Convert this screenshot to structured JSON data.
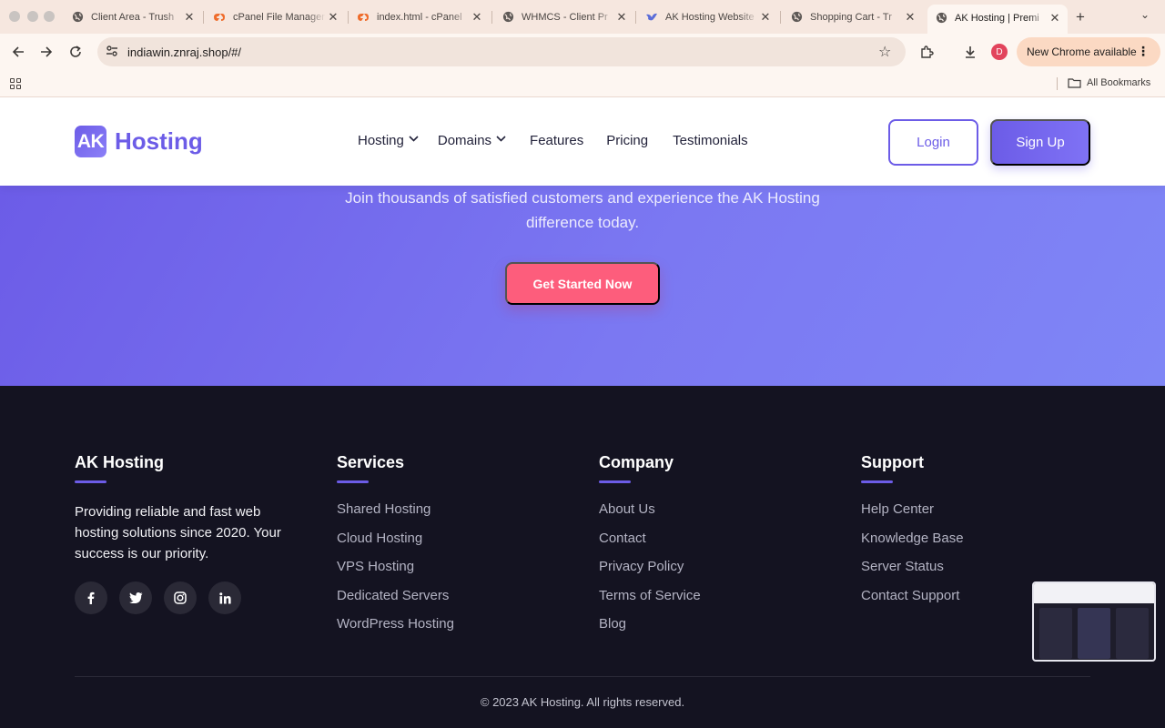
{
  "browser": {
    "tabs": [
      {
        "title": "Client Area - Trush",
        "favicon": "globe-icon"
      },
      {
        "title": "cPanel File Manager",
        "favicon": "cpanel-icon"
      },
      {
        "title": "index.html - cPanel",
        "favicon": "cpanel-icon"
      },
      {
        "title": "WHMCS - Client Pr",
        "favicon": "globe-icon"
      },
      {
        "title": "AK Hosting Website",
        "favicon": "bird-icon"
      },
      {
        "title": "Shopping Cart - Tr",
        "favicon": "globe-icon"
      },
      {
        "title": "AK Hosting | Premi",
        "favicon": "globe-icon",
        "active": true
      }
    ],
    "url": "indiawin.znraj.shop/#/",
    "profile_initial": "D",
    "update_label": "New Chrome available",
    "bookmarks_label": "All Bookmarks"
  },
  "header": {
    "logo_mark": "AK",
    "logo_text": "Hosting",
    "nav": [
      {
        "label": "Hosting",
        "dropdown": true
      },
      {
        "label": "Domains",
        "dropdown": true
      },
      {
        "label": "Features",
        "dropdown": false
      },
      {
        "label": "Pricing",
        "dropdown": false
      },
      {
        "label": "Testimonials",
        "dropdown": false
      }
    ],
    "login_label": "Login",
    "signup_label": "Sign Up"
  },
  "cta": {
    "text": "Join thousands of satisfied customers and experience the AK Hosting difference today.",
    "button_label": "Get Started Now"
  },
  "footer": {
    "about": {
      "title": "AK Hosting",
      "text": "Providing reliable and fast web hosting solutions since 2020. Your success is our priority.",
      "socials": [
        "facebook-icon",
        "twitter-icon",
        "instagram-icon",
        "linkedin-icon"
      ]
    },
    "services": {
      "title": "Services",
      "links": [
        "Shared Hosting",
        "Cloud Hosting",
        "VPS Hosting",
        "Dedicated Servers",
        "WordPress Hosting"
      ]
    },
    "company": {
      "title": "Company",
      "links": [
        "About Us",
        "Contact",
        "Privacy Policy",
        "Terms of Service",
        "Blog"
      ]
    },
    "support": {
      "title": "Support",
      "links": [
        "Help Center",
        "Knowledge Base",
        "Server Status",
        "Contact Support"
      ]
    },
    "copyright": "© 2023 AK Hosting. All rights reserved."
  },
  "colors": {
    "brand": "#6c5ce7",
    "cta_button": "#fd5d7c",
    "footer_bg": "#141321"
  }
}
